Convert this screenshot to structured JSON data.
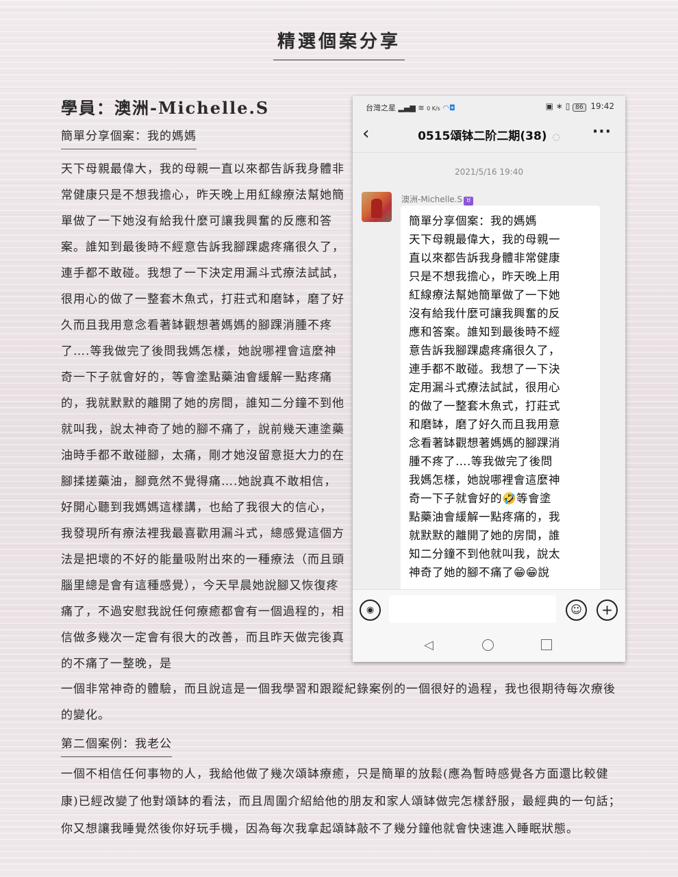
{
  "page_title": "精選個案分享",
  "student_title": "學員：澳洲-Michelle.S",
  "case1_heading": "簡單分享個案：我的媽媽",
  "case1_text": "天下母親最偉大，我的母親一直以來都告訴我身體非常健康只是不想我擔心，昨天晚上用紅線療法幫她簡單做了一下她沒有給我什麼可讓我興奮的反應和答案。誰知到最後時不經意告訴我腳踝處疼痛很久了，連手都不敢碰。我想了一下決定用漏斗式療法試試，很用心的做了一整套木魚式，打莊式和磨缽，磨了好久而且我用意念看著缽觀想著媽媽的腳踝消腫不疼了….等我做完了後問我媽怎樣，她說哪裡會這麼神奇一下子就會好的，等會塗點藥油會緩解一點疼痛的，我就默默的離開了她的房間，誰知二分鐘不到他就叫我，說太神奇了她的腳不痛了，說前幾天連塗藥油時手都不敢碰腳，太痛，剛才她沒留意挺大力的在腳揉搓藥油，腳竟然不覺得痛….她說真不敢相信，好開心聽到我媽媽這樣講，也給了我很大的信心， 我發現所有療法裡我最喜歡用漏斗式，總感覺這個方法是把壞的不好的能量吸附出來的一種療法（而且頭腦里總是會有這種感覺），今天早晨她說腳又恢復疼痛了，不過安慰我說任何療癒都會有一個過程的，相信做多幾次一定會有很大的改善，而且昨天做完後真的不痛了一整晚，是",
  "case1_text_cont": "一個非常神奇的體驗，而且說這是一個我學習和跟蹤紀錄案例的一個很好的過程，我也很期待每次療後的變化。",
  "case2_heading": "第二個案例：我老公",
  "case2_text": "一個不相信任何事物的人，我給他做了幾次頌缽療癒，只是簡單的放鬆(應為暫時感覺各方面還比較健康)已經改變了他對頌缽的看法，而且周圍介紹給他的朋友和家人頌缽做完怎樣舒服，最經典的一句話；你又想讓我睡覺然後你好玩手機，因為每次我拿起頌缽敲不了幾分鐘他就會快速進入睡眠狀態。",
  "phone": {
    "carrier": "台灣之星",
    "network_speed": "0 K/s",
    "battery": "86",
    "time": "19:42",
    "back_icon": "chevron-left-icon",
    "chat_title": "0515頌钵二阶二期(38)",
    "more_label": "···",
    "timestamp": "2021/5/16 19:40",
    "sender": "澳洲-Michelle.S",
    "sender_badge": "♉",
    "message_lines": [
      "簡單分享個案：我的媽媽",
      "天下母親最偉大，我的母親一",
      "直以來都告訴我身體非常健康",
      "只是不想我擔心，昨天晚上用",
      "紅線療法幫她簡單做了一下她",
      "沒有給我什麼可讓我興奮的反",
      "應和答案。誰知到最後時不經",
      "意告訴我腳踝處疼痛很久了，",
      "連手都不敢碰。我想了一下決",
      "定用漏斗式療法試試，很用心",
      "的做了一整套木魚式，打莊式",
      "和磨缽，磨了好久而且我用意",
      "念看著缽觀想著媽媽的腳踝消",
      "腫不疼了….等我做完了後問",
      "我媽怎樣，她說哪裡會這麼神",
      "奇一下子就會好的🤣等會塗",
      "點藥油會緩解一點疼痛的，我",
      "就默默的離開了她的房間，誰",
      "知二分鐘不到他就叫我，說太",
      "神奇了她的腳不痛了😁😁說"
    ]
  }
}
